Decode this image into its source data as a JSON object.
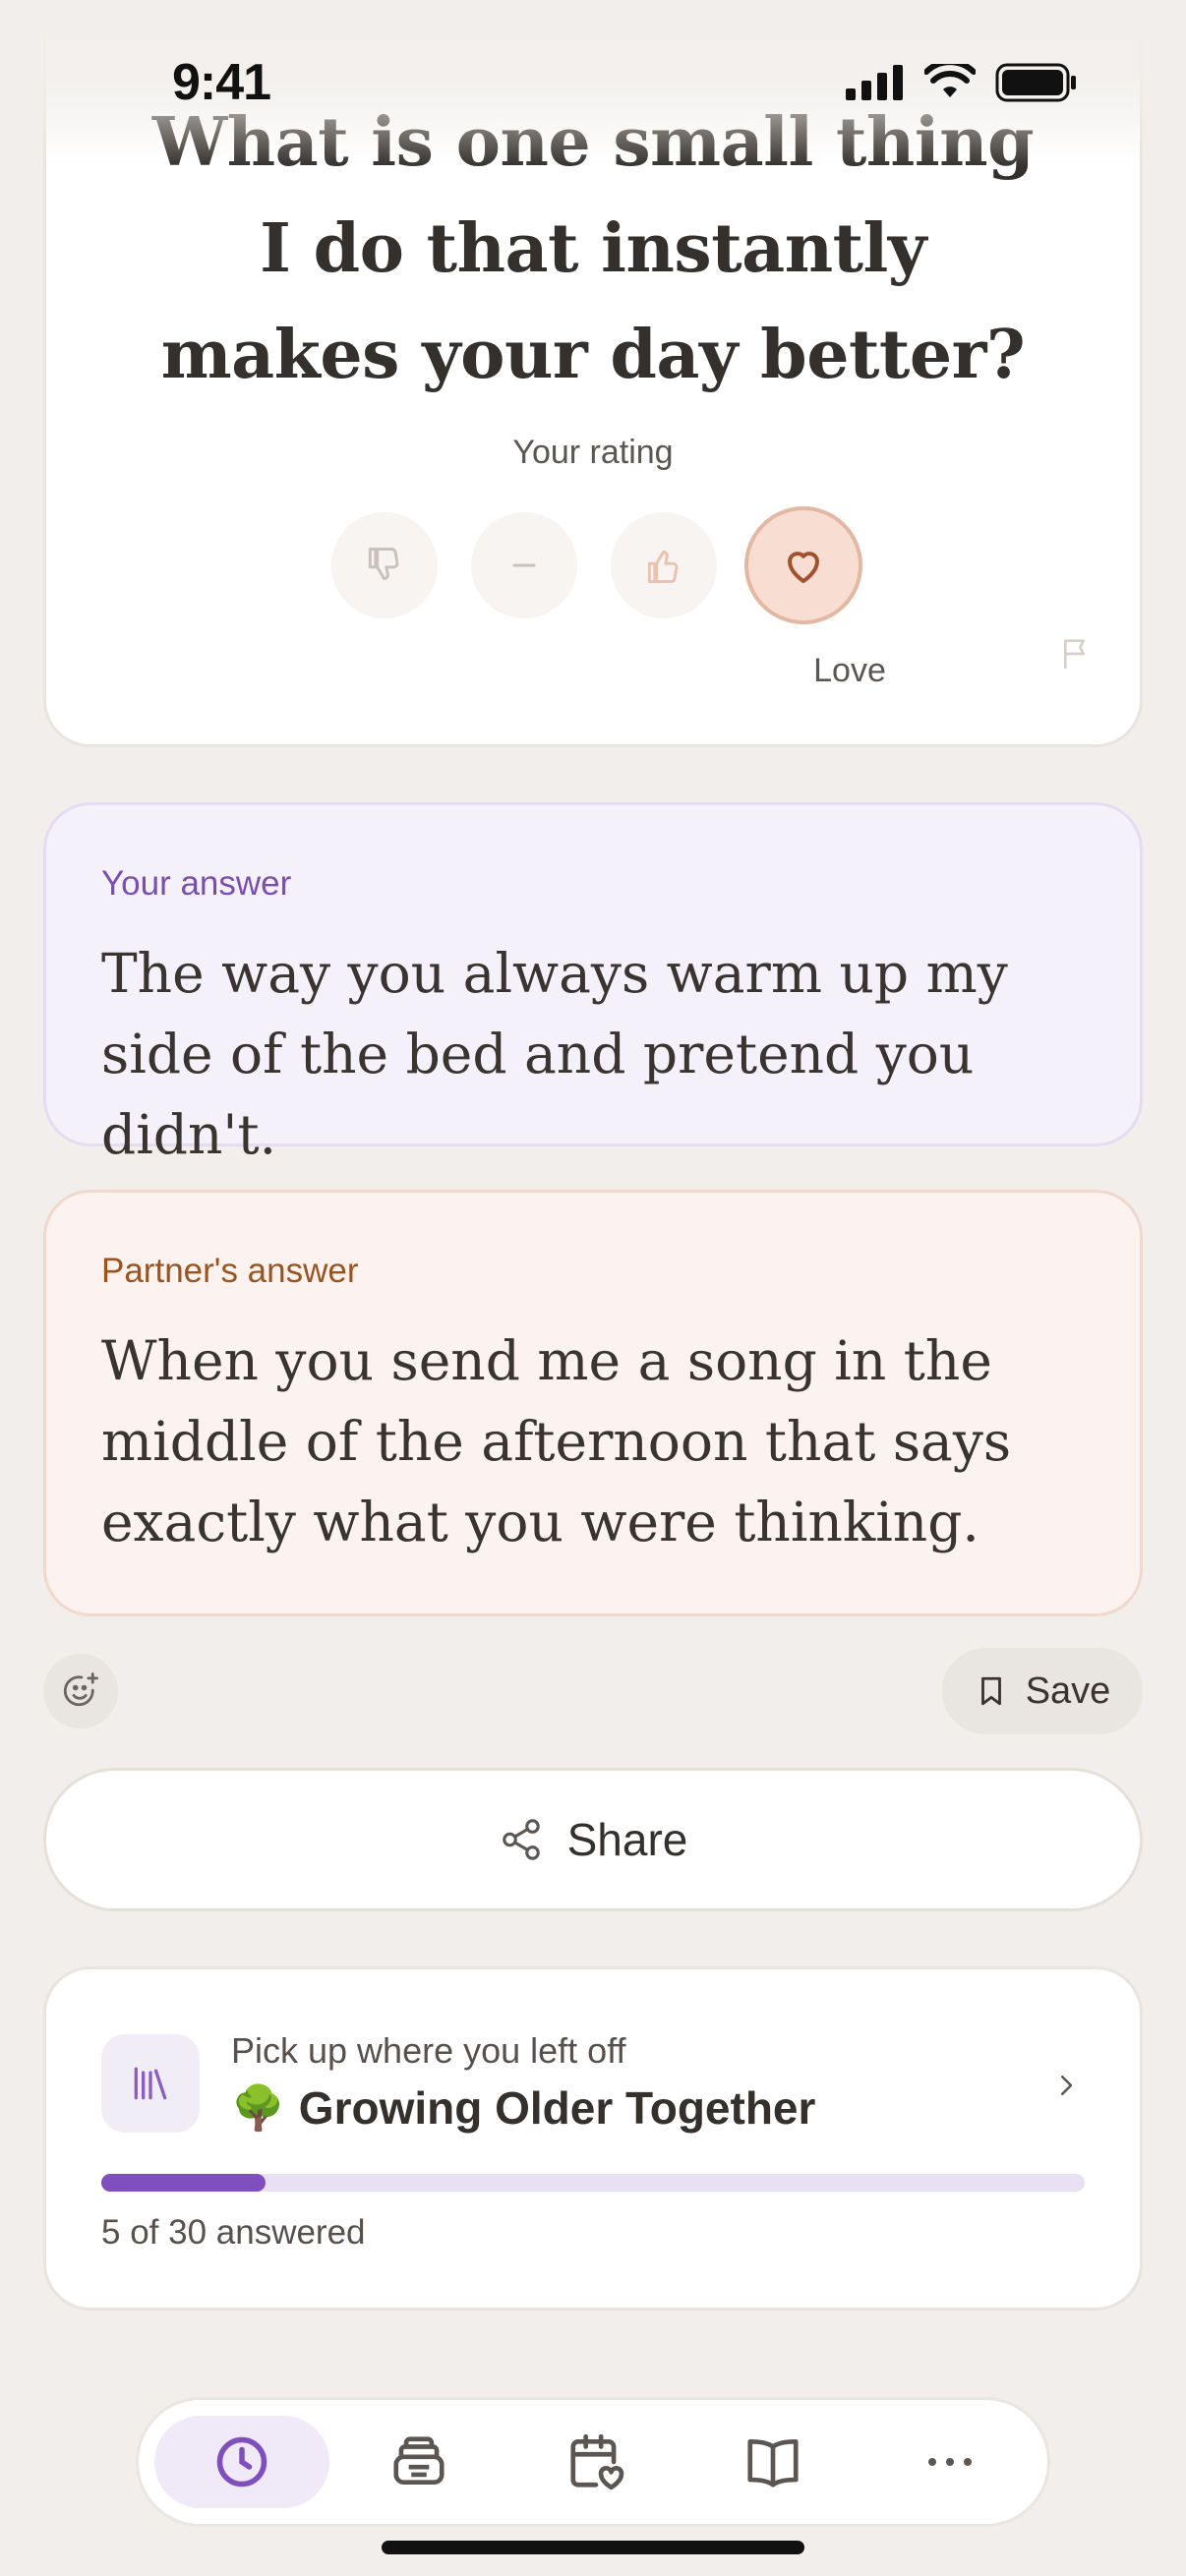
{
  "status_bar": {
    "time": "9:41"
  },
  "question": {
    "text": "What is one small thing I do that instantly makes your day better?",
    "rating_label": "Your rating",
    "selected_rating_label": "Love"
  },
  "your_answer": {
    "label": "Your answer",
    "text": "The way you always warm up my side of the bed and pretend you didn't."
  },
  "partner_answer": {
    "label": "Partner's answer",
    "text": "When you send me a song in the middle of the afternoon that says exactly what you were thinking."
  },
  "actions": {
    "save_label": "Save",
    "share_label": "Share"
  },
  "resume": {
    "subtitle": "Pick up where you left off",
    "emoji": "🌳",
    "title": "Growing Older Together",
    "progress_text": "5 of 30 answered",
    "answered": 5,
    "total": 30
  },
  "tab_bar": {
    "tabs": [
      {
        "icon": "clock-icon",
        "active": true
      },
      {
        "icon": "inbox-stack-icon",
        "active": false
      },
      {
        "icon": "calendar-heart-icon",
        "active": false
      },
      {
        "icon": "book-open-icon",
        "active": false
      },
      {
        "icon": "more-icon",
        "active": false
      }
    ]
  },
  "colors": {
    "accent_purple": "#7f4fbe",
    "love_accent": "#a0522d",
    "background": "#f1eeeb"
  }
}
